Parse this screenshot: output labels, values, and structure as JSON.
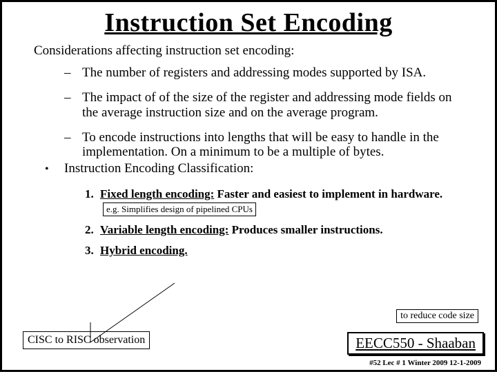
{
  "title": "Instruction Set Encoding",
  "intro": "Considerations affecting instruction set encoding:",
  "dashes": [
    "The number of registers and addressing modes supported by ISA.",
    "The impact of of the size of the register and addressing mode fields on the average instruction size and on the average program.",
    "To encode instructions into lengths that will be easy to handle in the implementation.  On a minimum to be a multiple of bytes."
  ],
  "classification_label": "Instruction Encoding Classification:",
  "numbered": [
    {
      "n": "1.",
      "lead": "Fixed length encoding:",
      "rest": "  Faster and easiest to implement in hardware."
    },
    {
      "n": "2.",
      "lead": "Variable length encoding:",
      "rest": "  Produces smaller instructions."
    },
    {
      "n": "3.",
      "lead": "Hybrid encoding.",
      "rest": ""
    }
  ],
  "anno_fixed": "e.g.  Simplifies design of pipelined CPUs",
  "anno_reduce": "to reduce code size",
  "cisc": "CISC to RISC observation",
  "course": "EECC550 - Shaaban",
  "footer": "#52   Lec # 1  Winter 2009  12-1-2009"
}
